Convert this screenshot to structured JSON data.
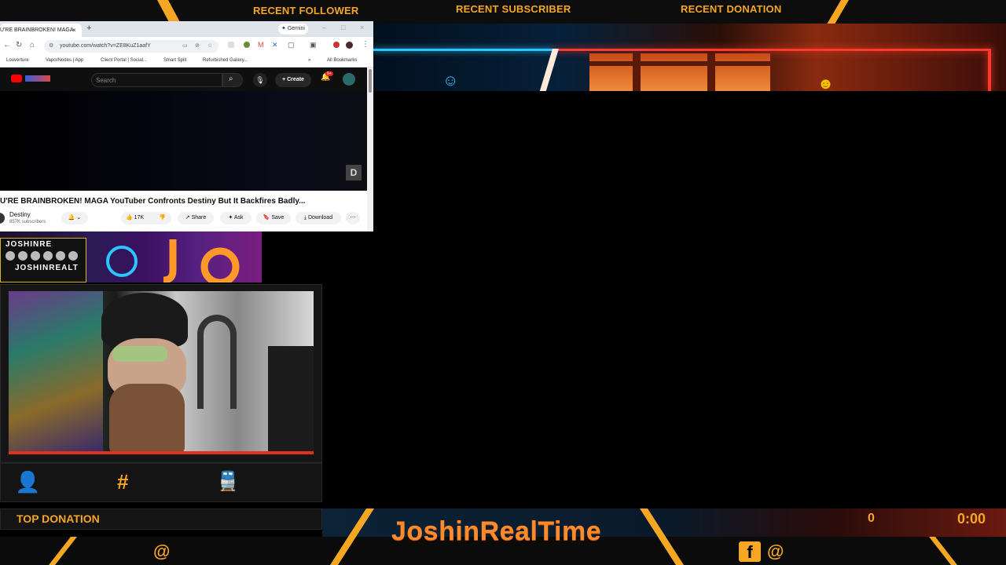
{
  "overlay": {
    "recent_follower_label": "RECENT FOLLOWER",
    "recent_subscriber_label": "RECENT SUBSCRIBER",
    "recent_donation_label": "RECENT DONATION",
    "top_donation_label": "TOP DONATION",
    "channel_name": "JoshinRealTime",
    "donation_count": "0",
    "timer": "0:00",
    "social_left": "@",
    "social_right": "@",
    "accent_color": "#f5a623"
  },
  "browser": {
    "tab_title": "U'RE BRAINBROKEN! MAGA",
    "new_tab": "+",
    "gemini_label": "Gemini",
    "url": "youtube.com/watch?v=ZE8KuZ1aafY",
    "bookmarks": [
      "Louverture",
      "VaporNodes | App",
      "Client Portal | Social...",
      "Smart Split",
      "Refurbished Galaxy..."
    ],
    "all_bookmarks": "All Bookmarks"
  },
  "youtube": {
    "search_placeholder": "Search",
    "create_label": "Create",
    "notification_count": "9+",
    "video_title": "U'RE BRAINBROKEN! MAGA YouTuber Confronts Destiny But It Backfires Badly...",
    "channel": "Destiny",
    "subscribers": "857K subscribers",
    "likes": "17K",
    "share_label": "Share",
    "ask_label": "Ask",
    "save_label": "Save",
    "download_label": "Download"
  },
  "promo": {
    "line1": "JOSHINRE",
    "line2": "JOSHINREALT"
  }
}
